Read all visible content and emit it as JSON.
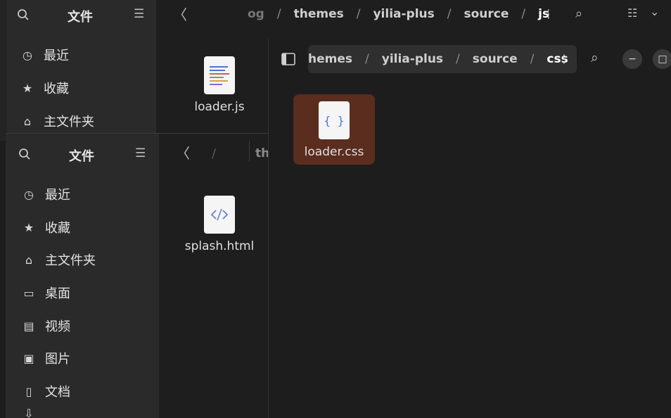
{
  "winA": {
    "sidebar": {
      "title": "文件",
      "items": [
        {
          "label": "最近",
          "icon": "clock-icon"
        },
        {
          "label": "收藏",
          "icon": "star-icon"
        },
        {
          "label": "主文件夹",
          "icon": "home-icon"
        }
      ]
    },
    "path": [
      "og",
      "themes",
      "yilia-plus",
      "source",
      "js"
    ],
    "files": [
      {
        "name": "loader.js",
        "type": "text-file-icon"
      }
    ]
  },
  "winB": {
    "sidebar": {
      "title": "文件",
      "items": [
        {
          "label": "最近",
          "icon": "clock-icon"
        },
        {
          "label": "收藏",
          "icon": "star-icon"
        },
        {
          "label": "主文件夹",
          "icon": "home-icon"
        },
        {
          "label": "桌面",
          "icon": "desktop-icon"
        },
        {
          "label": "视频",
          "icon": "video-icon"
        },
        {
          "label": "图片",
          "icon": "image-icon"
        },
        {
          "label": "文档",
          "icon": "document-icon"
        }
      ]
    },
    "path_fragment": "th",
    "files": [
      {
        "name": "splash.html",
        "type": "code-file-icon"
      }
    ]
  },
  "winC": {
    "path": [
      "hemes",
      "yilia-plus",
      "source",
      "css"
    ],
    "files": [
      {
        "name": "loader.css",
        "type": "css-file-icon",
        "selected": true
      }
    ]
  },
  "colors": {
    "selection": "#5a2d1e",
    "bg": "#1d1d1d",
    "sidebar": "#2a2a2a"
  }
}
